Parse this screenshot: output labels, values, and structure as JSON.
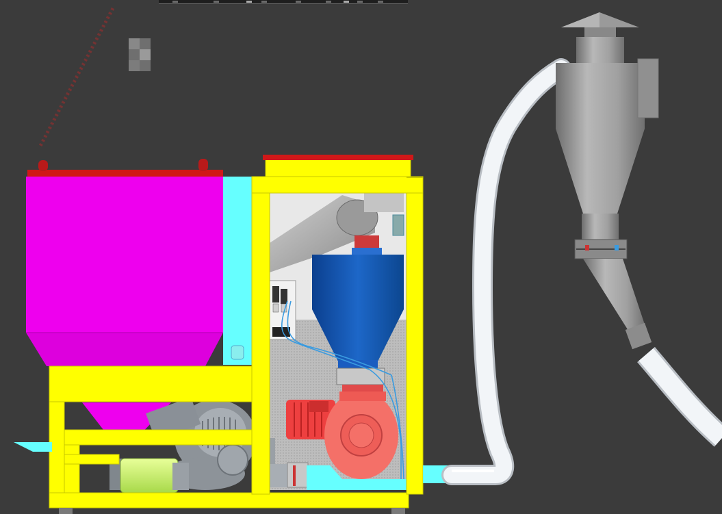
{
  "colors": {
    "background": "#3b3b3b",
    "hopper": "#ee00ee",
    "frame": "#ffff00",
    "panel": "#66ffff",
    "lid": "#e02020",
    "cone_blue": "#1459b8",
    "motor_red": "#f07068",
    "hose": "#eef2f6",
    "cyclone": "#9a9a9a",
    "filter_green": "#ccff66",
    "blower": "#9aa0a6"
  },
  "icons": [
    "toolbar-strip",
    "pixel-thumbnail-icon"
  ]
}
